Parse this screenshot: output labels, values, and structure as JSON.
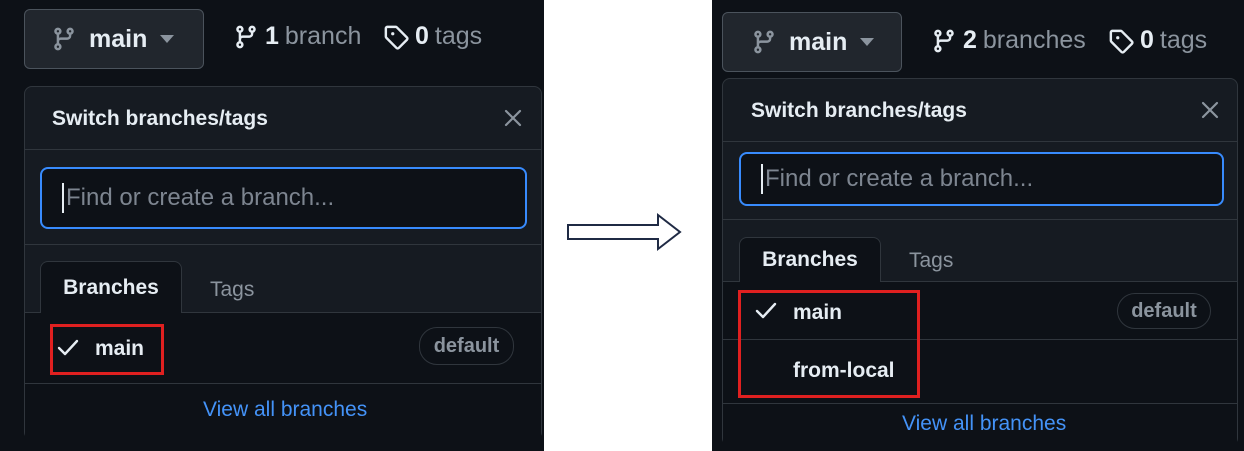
{
  "left": {
    "branch_button": {
      "label": "main",
      "icon": "git-branch-icon"
    },
    "branch_count": {
      "count": "1",
      "label": "branch",
      "icon": "git-branch-icon"
    },
    "tag_count": {
      "count": "0",
      "label": "tags",
      "icon": "tag-icon"
    },
    "dropdown": {
      "title": "Switch branches/tags",
      "search_placeholder": "Find or create a branch...",
      "tabs": [
        "Branches",
        "Tags"
      ],
      "items": [
        {
          "name": "main",
          "selected": true,
          "badge": "default"
        }
      ],
      "view_all": "View all branches"
    }
  },
  "right": {
    "branch_button": {
      "label": "main",
      "icon": "git-branch-icon"
    },
    "branch_count": {
      "count": "2",
      "label": "branches",
      "icon": "git-branch-icon"
    },
    "tag_count": {
      "count": "0",
      "label": "tags",
      "icon": "tag-icon"
    },
    "dropdown": {
      "title": "Switch branches/tags",
      "search_placeholder": "Find or create a branch...",
      "tabs": [
        "Branches",
        "Tags"
      ],
      "items": [
        {
          "name": "main",
          "selected": true,
          "badge": "default"
        },
        {
          "name": "from-local",
          "selected": false
        }
      ],
      "view_all": "View all branches"
    }
  },
  "colors": {
    "accent": "#388bfd",
    "link": "#4493f8",
    "highlight": "#e02020",
    "background": "#0d1117"
  }
}
